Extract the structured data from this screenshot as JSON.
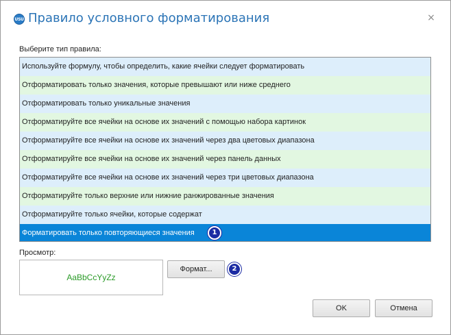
{
  "window": {
    "title": "Правило условного форматирования",
    "app_icon_text": "USU",
    "close_glyph": "×"
  },
  "rule_type": {
    "label": "Выберите тип правила:",
    "items": [
      {
        "label": "Используйте формулу, чтобы определить, какие ячейки следует форматировать",
        "color": "#ddeefb"
      },
      {
        "label": "Отформатировать только значения, которые превышают или ниже среднего",
        "color": "#e2f7e1"
      },
      {
        "label": "Отформатировать только уникальные значения",
        "color": "#ddeefb"
      },
      {
        "label": "Отформатируйте все ячейки на основе их значений с помощью набора картинок",
        "color": "#e2f7e1"
      },
      {
        "label": "Отформатируйте все ячейки на основе их значений через два цветовых диапазона",
        "color": "#ddeefb"
      },
      {
        "label": "Отформатируйте все ячейки на основе их значений через панель данных",
        "color": "#e2f7e1"
      },
      {
        "label": "Отформатируйте все ячейки на основе их значений через три цветовых диапазона",
        "color": "#ddeefb"
      },
      {
        "label": "Отформатируйте только верхние или нижние ранжированные значения",
        "color": "#e2f7e1"
      },
      {
        "label": "Отформатируйте только ячейки, которые содержат",
        "color": "#ddeefb"
      },
      {
        "label": "Форматировать только повторяющиеся значения",
        "color": "#0a85d8",
        "selected": true,
        "badge": "1"
      }
    ]
  },
  "preview": {
    "label": "Просмотр:",
    "sample_text": "AaBbCcYyZz",
    "sample_color": "#2a9a27"
  },
  "format_button": {
    "label": "Формат...",
    "badge": "2"
  },
  "ok_button": {
    "label": "OK"
  },
  "cancel_button": {
    "label": "Отмена"
  }
}
